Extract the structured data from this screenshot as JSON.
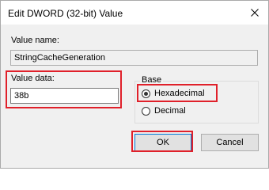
{
  "window": {
    "title": "Edit DWORD (32-bit) Value"
  },
  "value_name": {
    "label": "Value name:",
    "value": "StringCacheGeneration"
  },
  "value_data": {
    "label": "Value data:",
    "value": "38b"
  },
  "base": {
    "label": "Base",
    "options": [
      {
        "label": "Hexadecimal",
        "checked": true
      },
      {
        "label": "Decimal",
        "checked": false
      }
    ]
  },
  "buttons": {
    "ok": "OK",
    "cancel": "Cancel"
  },
  "colors": {
    "highlight": "#e0202a",
    "dialog_bg": "#f0f0f0"
  }
}
